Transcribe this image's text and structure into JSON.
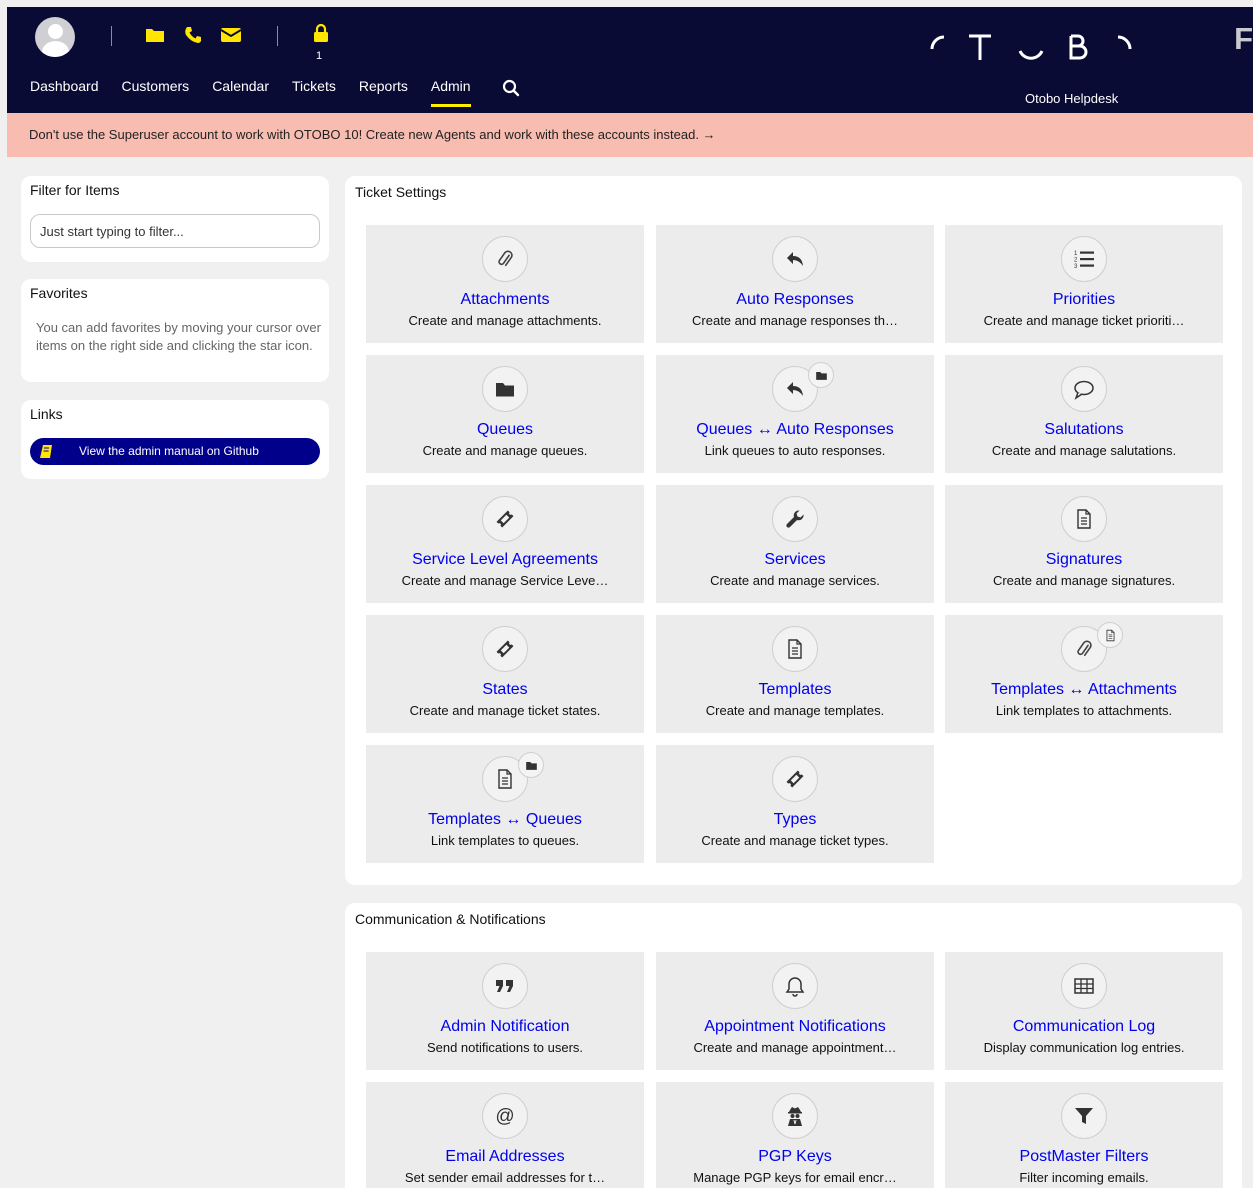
{
  "header": {
    "lock_count": "1",
    "nav": [
      "Dashboard",
      "Customers",
      "Calendar",
      "Tickets",
      "Reports",
      "Admin"
    ],
    "brand": "Otobo Helpdesk",
    "logo_text": "OTOBO",
    "corner_letter": "F",
    "accent": "#ffee00",
    "icon_yellow": "#ffe500"
  },
  "banner": {
    "text": "Don't use the Superuser account to work with OTOBO 10! Create new Agents and work with these accounts instead. →"
  },
  "sidebar": {
    "filter": {
      "title": "Filter for Items",
      "placeholder": "Just start typing to filter..."
    },
    "favorites": {
      "title": "Favorites",
      "text": "You can add favorites by moving your cursor over items on the right side and clicking the star icon."
    },
    "links": {
      "title": "Links",
      "button": "View the admin manual on Github"
    }
  },
  "ticket_settings": {
    "title": "Ticket Settings",
    "tiles": [
      {
        "title": "Attachments",
        "desc": "Create and manage attachments.",
        "icon": "paperclip-icon"
      },
      {
        "title": "Auto Responses",
        "desc": "Create and manage responses th…",
        "icon": "reply-icon"
      },
      {
        "title": "Priorities",
        "desc": "Create and manage ticket prioriti…",
        "icon": "ordered-list-icon"
      },
      {
        "title": "Queues",
        "desc": "Create and manage queues.",
        "icon": "folder-icon"
      },
      {
        "title": "Queues ↔ Auto Responses",
        "desc": "Link queues to auto responses.",
        "icon": "reply-icon",
        "badge": "folder-icon"
      },
      {
        "title": "Salutations",
        "desc": "Create and manage salutations.",
        "icon": "speech-bubble-icon"
      },
      {
        "title": "Service Level Agreements",
        "desc": "Create and manage Service Leve…",
        "icon": "ticket-icon"
      },
      {
        "title": "Services",
        "desc": "Create and manage services.",
        "icon": "wrench-icon"
      },
      {
        "title": "Signatures",
        "desc": "Create and manage signatures.",
        "icon": "document-icon"
      },
      {
        "title": "States",
        "desc": "Create and manage ticket states.",
        "icon": "ticket-icon"
      },
      {
        "title": "Templates",
        "desc": "Create and manage templates.",
        "icon": "document-icon"
      },
      {
        "title": "Templates ↔ Attachments",
        "desc": "Link templates to attachments.",
        "icon": "paperclip-icon",
        "badge": "document-icon"
      },
      {
        "title": "Templates ↔ Queues",
        "desc": "Link templates to queues.",
        "icon": "document-icon",
        "badge": "folder-icon"
      },
      {
        "title": "Types",
        "desc": "Create and manage ticket types.",
        "icon": "ticket-icon"
      }
    ]
  },
  "communication": {
    "title": "Communication & Notifications",
    "tiles": [
      {
        "title": "Admin Notification",
        "desc": "Send notifications to users.",
        "icon": "quote-icon"
      },
      {
        "title": "Appointment Notifications",
        "desc": "Create and manage appointment…",
        "icon": "bell-icon"
      },
      {
        "title": "Communication Log",
        "desc": "Display communication log entries.",
        "icon": "table-icon"
      },
      {
        "title": "Email Addresses",
        "desc": "Set sender email addresses for t…",
        "icon": "at-icon"
      },
      {
        "title": "PGP Keys",
        "desc": "Manage PGP keys for email encr…",
        "icon": "user-secret-icon"
      },
      {
        "title": "PostMaster Filters",
        "desc": "Filter incoming emails.",
        "icon": "filter-icon"
      }
    ]
  }
}
